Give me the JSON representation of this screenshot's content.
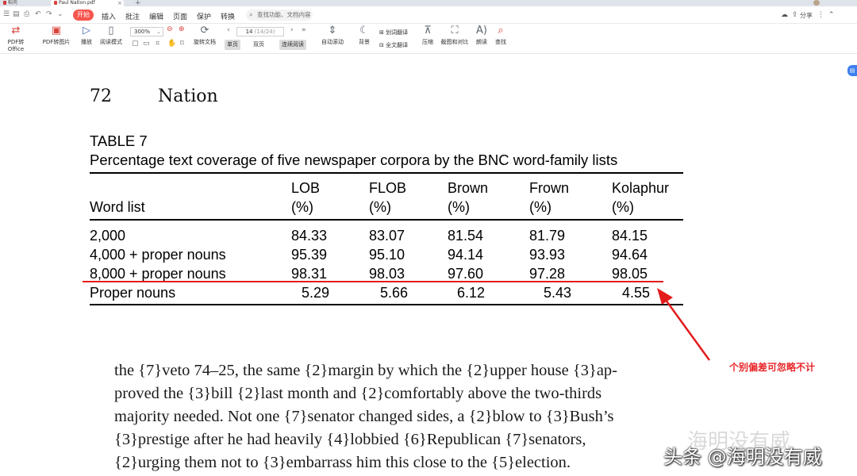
{
  "titlebar": {
    "tabs": [
      {
        "label": "稻壳"
      },
      {
        "label": "Paul Nation.pdf"
      }
    ],
    "add_tab": "+",
    "close_tab": "×"
  },
  "menubar": {
    "items": [
      "开始",
      "插入",
      "批注",
      "编辑",
      "页面",
      "保护",
      "转换"
    ],
    "search_placeholder": "查找功能、文档内容",
    "share_label": "分享"
  },
  "ribbon": {
    "buttons": [
      {
        "label": "PDF转Office",
        "icon": "pdf-to-office-icon"
      },
      {
        "label": "PDF转图片",
        "icon": "pdf-to-image-icon"
      },
      {
        "label": "播放",
        "icon": "play-icon"
      },
      {
        "label": "阅读模式",
        "icon": "read-mode-icon"
      },
      {
        "label": "旋转文档",
        "icon": "rotate-icon"
      },
      {
        "label": "自动滚动",
        "icon": "auto-scroll-icon"
      },
      {
        "label": "背景",
        "icon": "background-icon"
      },
      {
        "label": "划词翻译",
        "icon": "translate-icon"
      },
      {
        "label": "全文翻译",
        "icon": "full-translate-icon"
      },
      {
        "label": "压缩",
        "icon": "compress-icon"
      },
      {
        "label": "截图和对比",
        "icon": "screenshot-icon"
      },
      {
        "label": "朗读",
        "icon": "read-aloud-icon"
      },
      {
        "label": "查找",
        "icon": "find-icon"
      }
    ],
    "zoom": "300%",
    "page_current": "14",
    "page_total": "(14/24)",
    "view_single": "单页",
    "view_double": "双页",
    "view_continuous": "连续阅读"
  },
  "document": {
    "page_number": "72",
    "running_head": "Nation",
    "table": {
      "label": "TABLE 7",
      "caption": "Percentage text coverage of five newspaper corpora by the BNC word-family lists",
      "header_col0": "Word list",
      "columns": [
        {
          "name": "LOB",
          "unit": "(%)"
        },
        {
          "name": "FLOB",
          "unit": "(%)"
        },
        {
          "name": "Brown",
          "unit": "(%)"
        },
        {
          "name": "Frown",
          "unit": "(%)"
        },
        {
          "name": "Kolaphur",
          "unit": "(%)"
        }
      ],
      "rows": [
        {
          "label": "2,000",
          "values": [
            "84.33",
            "83.07",
            "81.54",
            "81.79",
            "84.15"
          ]
        },
        {
          "label": "4,000 + proper nouns",
          "values": [
            "95.39",
            "95.10",
            "94.14",
            "93.93",
            "94.64"
          ]
        },
        {
          "label": "8,000 + proper nouns",
          "values": [
            "98.31",
            "98.03",
            "97.60",
            "97.28",
            "98.05"
          ]
        },
        {
          "label": "Proper nouns",
          "values": [
            "5.29",
            "5.66",
            "6.12",
            "5.43",
            "4.55"
          ]
        }
      ]
    },
    "annotation": "个别偏差可忽略不计",
    "paragraph_lines": [
      "the {7}veto 74–25, the same {2}margin by which the {2}upper house {3}ap-",
      "proved the {3}bill {2}last month and {2}comfortably above the two-thirds",
      "majority needed. Not one {7}senator changed sides, a {2}blow to {3}Bush’s",
      "{3}prestige after he had heavily {4}lobbied {6}Republican {7}senators,",
      "{2}urging them not to {3}embarrass him this close to the {5}election."
    ],
    "watermark_faint": "海明没有威",
    "watermark": "头条 @海明没有威"
  },
  "colors": {
    "accent_red": "#e21b1b",
    "start_tab": "#f6554d",
    "float_button": "#3d7ff0"
  }
}
